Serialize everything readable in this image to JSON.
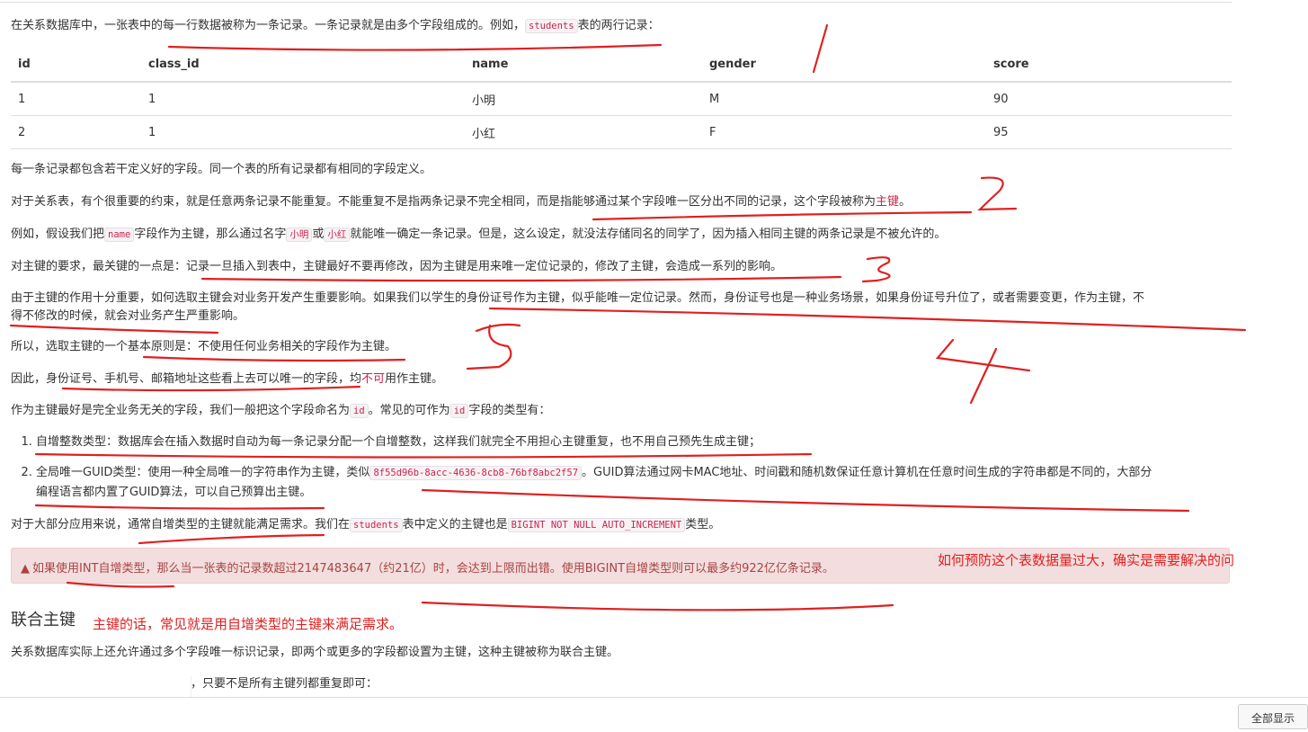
{
  "p1": {
    "pre": "在关系数据库中，一张表中的每一行数据被称为一条记录。一条记录就是由多个字段组成的。例如，",
    "code": "students",
    "post": "表的两行记录："
  },
  "table": {
    "headers": [
      "id",
      "class_id",
      "name",
      "gender",
      "score"
    ],
    "rows": [
      [
        "1",
        "1",
        "小明",
        "M",
        "90"
      ],
      [
        "2",
        "1",
        "小红",
        "F",
        "95"
      ]
    ]
  },
  "p2": "每一条记录都包含若干定义好的字段。同一个表的所有记录都有相同的字段定义。",
  "p3": {
    "pre": "对于关系表，有个很重要的约束，就是任意两条记录不能重复。不能重复不是指两条记录不完全相同，而是指能够通过某个字段唯一区分出不同的记录，这个字段被称为",
    "hl": "主键",
    "post": "。"
  },
  "p4": {
    "a": "例如，假设我们把",
    "code1": "name",
    "b": "字段作为主键，那么通过名字",
    "hl1": "小明",
    "c": "或",
    "hl2": "小红",
    "d": "就能唯一确定一条记录。但是，这么设定，就没法存储同名的同学了，因为插入相同主键的两条记录是不被允许的。"
  },
  "p5": "对主键的要求，最关键的一点是：记录一旦插入到表中，主键最好不要再修改，因为主键是用来唯一定位记录的，修改了主键，会造成一系列的影响。",
  "p6a": "由于主键的作用十分重要，如何选取主键会对业务开发产生重要影响。如果我们以学生的身份证号作为主键，似乎能唯一定位记录。然而，身份证号也是一种业务场景，如果身份证号升位了，或者需要变更，作为主键，不",
  "p6b": "得不修改的时候，就会对业务产生严重影响。",
  "p7": "所以，选取主键的一个基本原则是：不使用任何业务相关的字段作为主键。",
  "p8": {
    "pre": "因此，身份证号、手机号、邮箱地址这些看上去可以唯一的字段，均",
    "hl": "不可",
    "post": "用作主键。"
  },
  "p9": {
    "a": "作为主键最好是完全业务无关的字段，我们一般把这个字段命名为",
    "code1": "id",
    "b": "。常见的可作为",
    "code2": "id",
    "c": "字段的类型有："
  },
  "list": {
    "item1": "自增整数类型：数据库会在插入数据时自动为每一条记录分配一个自增整数，这样我们就完全不用担心主键重复，也不用自己预先生成主键；",
    "item2_pre": "全局唯一GUID类型：使用一种全局唯一的字符串作为主键，类似",
    "item2_code": "8f55d96b-8acc-4636-8cb8-76bf8abc2f57",
    "item2_post": "。GUID算法通过网卡MAC地址、时间戳和随机数保证任意计算机在任意时间生成的字符串都是不同的，大部分",
    "item2_line2": "编程语言都内置了GUID算法，可以自己预算出主键。"
  },
  "p10": {
    "a": "对于大部分应用来说，通常自增类型的主键就能满足需求。我们在",
    "code1": "students",
    "b": "表中定义的主键也是",
    "code2": "BIGINT NOT NULL AUTO_INCREMENT",
    "c": "类型。"
  },
  "alert": "如果使用INT自增类型，那么当一张表的记录数超过2147483647（约21亿）时，会达到上限而出错。使用BIGINT自增类型则可以最多约922亿亿条记录。",
  "heading": "联合主键",
  "p11": "关系数据库实际上还允许通过多个字段唯一标识记录，即两个或更多的字段都设置为主键，这种主键被称为联合主键。",
  "p12": "，只要不是所有主键列都重复即可：",
  "notes": {
    "n1": "如何预防这个表数据量过大，确实是需要解决的问",
    "n2": "主键的话，常见就是用自增类型的主键来满足需求。"
  },
  "button": "全部显示",
  "colors": {
    "code": "#c7254e",
    "alert_bg": "#f2dede",
    "alert_text": "#a94442",
    "annotation": "#e02020"
  }
}
